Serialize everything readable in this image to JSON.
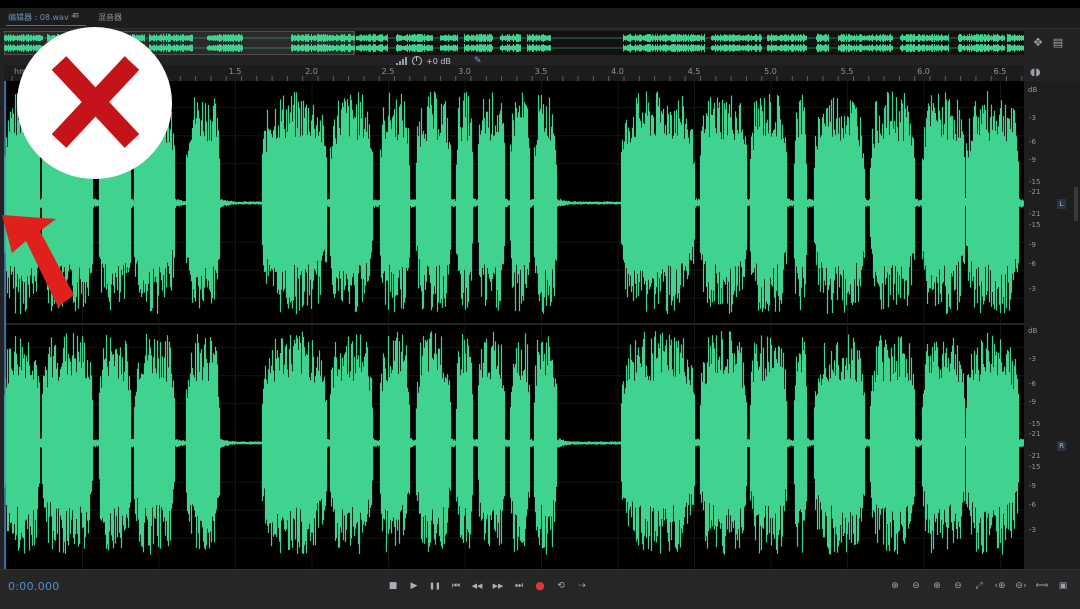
{
  "tabs": {
    "editor": "编辑器 : 08.wav *",
    "menu_glyph": "≡",
    "mixer": "混音器"
  },
  "ruler": {
    "unit_label": "hms",
    "ticks": [
      "1.5",
      "2.0",
      "2.5",
      "3.0",
      "3.5",
      "4.0",
      "4.5",
      "5.0",
      "5.5",
      "6.0",
      "6.5"
    ]
  },
  "hud": {
    "gain": "+0 dB"
  },
  "db_scale": {
    "unit": "dB",
    "labels": [
      "-3",
      "-6",
      "-9",
      "-15",
      "-21",
      "-21",
      "-15",
      "-9",
      "-6",
      "-3"
    ],
    "left_channel": "L",
    "right_channel": "R"
  },
  "status": {
    "time": "0:00.000"
  },
  "transport": {
    "stop": "■",
    "play": "▶",
    "pause": "❚❚",
    "to_start": "⏮",
    "rewind": "◀◀",
    "fast_forward": "▶▶",
    "to_end": "⏭",
    "record": "●",
    "loop": "⟲",
    "skip": "⇢"
  },
  "zoom": {
    "zoom_in_amp": "⊕",
    "zoom_out_amp": "⊖",
    "zoom_in_time": "⊕",
    "zoom_out_time": "⊖",
    "zoom_full": "⤢",
    "zoom_in_left": "‹⊕",
    "zoom_out_right": "⊖›",
    "zoom_fit": "⟺",
    "zoom_sel": "▣"
  },
  "colors": {
    "waveform": "#3fd38f",
    "time_accent": "#4f8ed6",
    "overlay_x": "#c4141a",
    "arrow": "#e0201c"
  }
}
